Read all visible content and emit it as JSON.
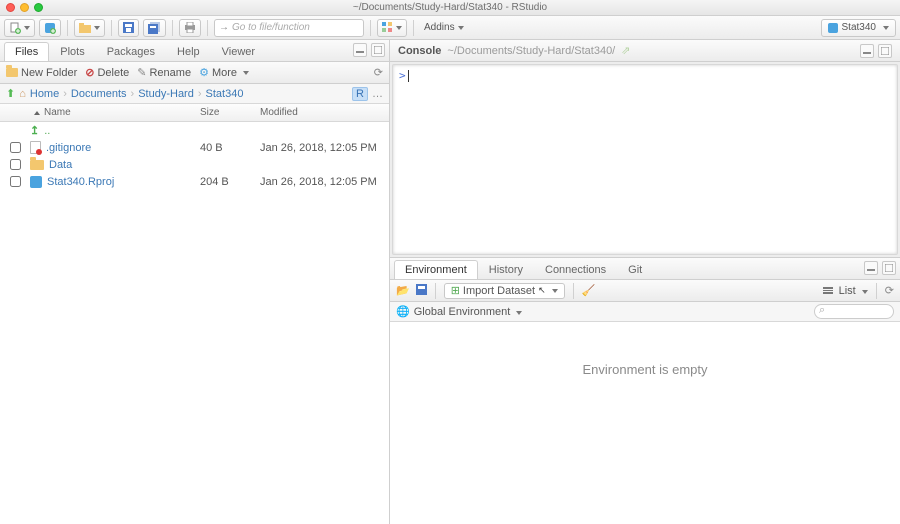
{
  "window": {
    "title": "~/Documents/Study-Hard/Stat340 - RStudio"
  },
  "toolbar": {
    "goto_placeholder": "Go to file/function",
    "addins_label": "Addins",
    "project_label": "Stat340"
  },
  "files_pane": {
    "tabs": [
      "Files",
      "Plots",
      "Packages",
      "Help",
      "Viewer"
    ],
    "active_tab": "Files",
    "actions": {
      "new_folder": "New Folder",
      "delete": "Delete",
      "rename": "Rename",
      "more": "More"
    },
    "breadcrumb": [
      "Home",
      "Documents",
      "Study-Hard",
      "Stat340"
    ],
    "columns": {
      "name": "Name",
      "size": "Size",
      "modified": "Modified"
    },
    "rows": [
      {
        "kind": "up",
        "name": "..",
        "size": "",
        "modified": ""
      },
      {
        "kind": "file",
        "name": ".gitignore",
        "size": "40 B",
        "modified": "Jan 26, 2018, 12:05 PM"
      },
      {
        "kind": "folder",
        "name": "Data",
        "size": "",
        "modified": ""
      },
      {
        "kind": "rproj",
        "name": "Stat340.Rproj",
        "size": "204 B",
        "modified": "Jan 26, 2018, 12:05 PM"
      }
    ]
  },
  "console": {
    "tab_label": "Console",
    "path": "~/Documents/Study-Hard/Stat340/",
    "prompt": ">"
  },
  "env_pane": {
    "tabs": [
      "Environment",
      "History",
      "Connections",
      "Git"
    ],
    "active_tab": "Environment",
    "import_label": "Import Dataset",
    "list_label": "List",
    "scope_label": "Global Environment",
    "empty_msg": "Environment is empty"
  }
}
